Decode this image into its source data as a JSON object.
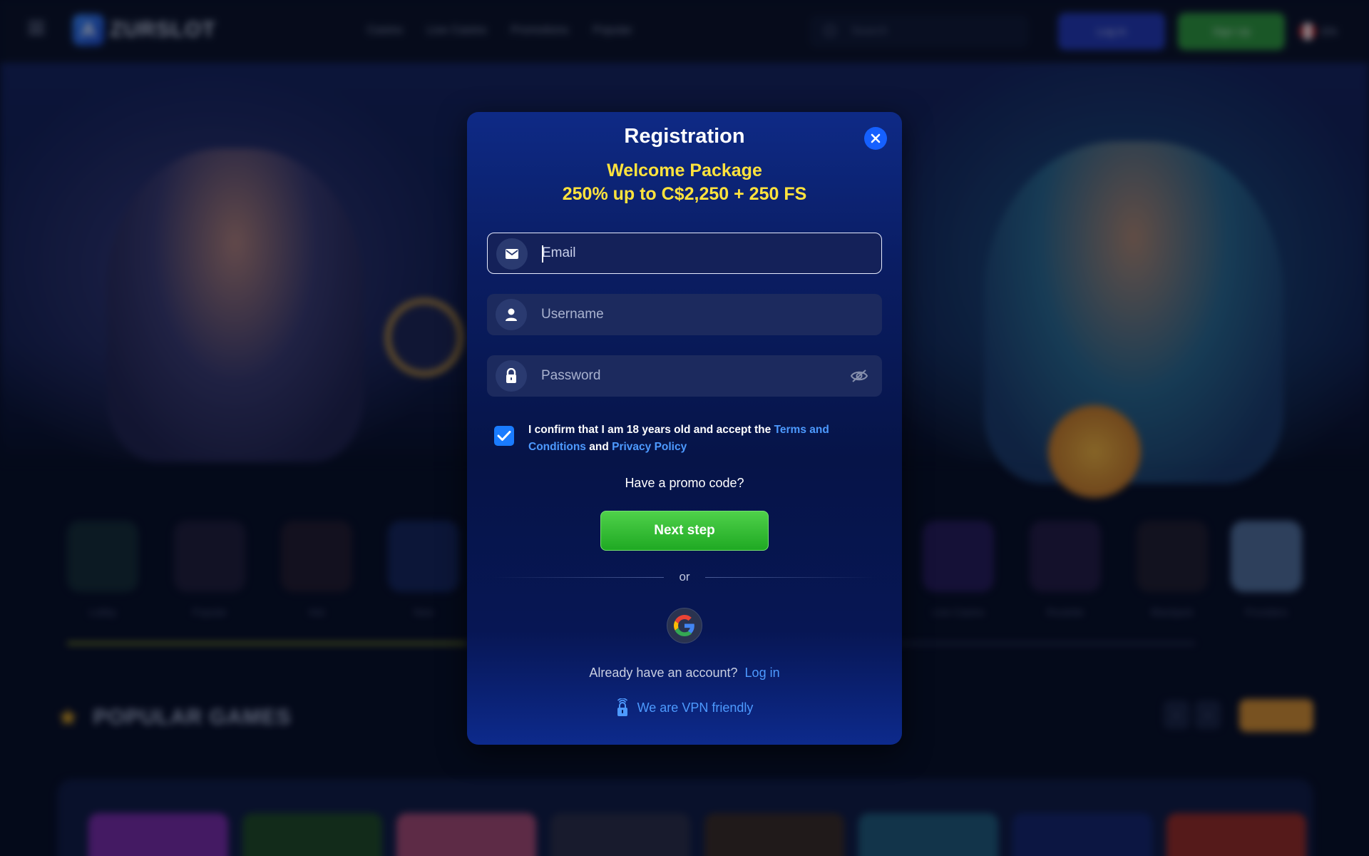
{
  "site": {
    "logo_letter": "A",
    "logo_text": "ZURSLOT",
    "nav": [
      "Casino",
      "Live Casino",
      "Promotions",
      "Popular"
    ],
    "search_placeholder": "Search",
    "login_label": "Log in",
    "signup_label": "Sign Up",
    "language": "EN"
  },
  "categories": [
    {
      "label": "Lobby",
      "color": "#1f4a3a"
    },
    {
      "label": "Popular",
      "color": "#3a2a3a"
    },
    {
      "label": "Hot",
      "color": "#3a2a2a"
    },
    {
      "label": "New",
      "color": "#1a2f6a"
    },
    {
      "label": "Live Casino",
      "color": "#3a1f6a"
    },
    {
      "label": "Roulette",
      "color": "#3a1f4a"
    },
    {
      "label": "Blackjack",
      "color": "#3a2f2a"
    },
    {
      "label": "Providers",
      "color": "#5a7aa0"
    }
  ],
  "popular": {
    "title": "POPULAR GAMES",
    "prev": "‹",
    "next": "›"
  },
  "games": [
    "#9a3ad0",
    "#2f6a2a",
    "#d85a8a",
    "#3a3a5a",
    "#5a3a2a",
    "#2a7aa0",
    "#1a2f8a",
    "#c03a2a"
  ],
  "modal": {
    "title": "Registration",
    "promo_line1": "Welcome Package",
    "promo_line2": "250% up to C$2,250 + 250 FS",
    "email_placeholder": "Email",
    "username_placeholder": "Username",
    "password_placeholder": "Password",
    "consent_prefix": "I confirm that I am 18 years old and accept the ",
    "terms_link": "Terms and Conditions",
    "consent_and": " and ",
    "privacy_link": "Privacy Policy",
    "consent_checked": true,
    "promo_code_label": "Have a promo code?",
    "next_step_label": "Next step",
    "or_label": "or",
    "already_label": "Already have an account?",
    "login_link": "Log in",
    "vpn_label": "We are VPN friendly"
  },
  "colors": {
    "accent_blue": "#1560ff",
    "promo_yellow": "#ffe33d",
    "next_green": "#2fbf2f",
    "link_blue": "#4d9aff"
  }
}
